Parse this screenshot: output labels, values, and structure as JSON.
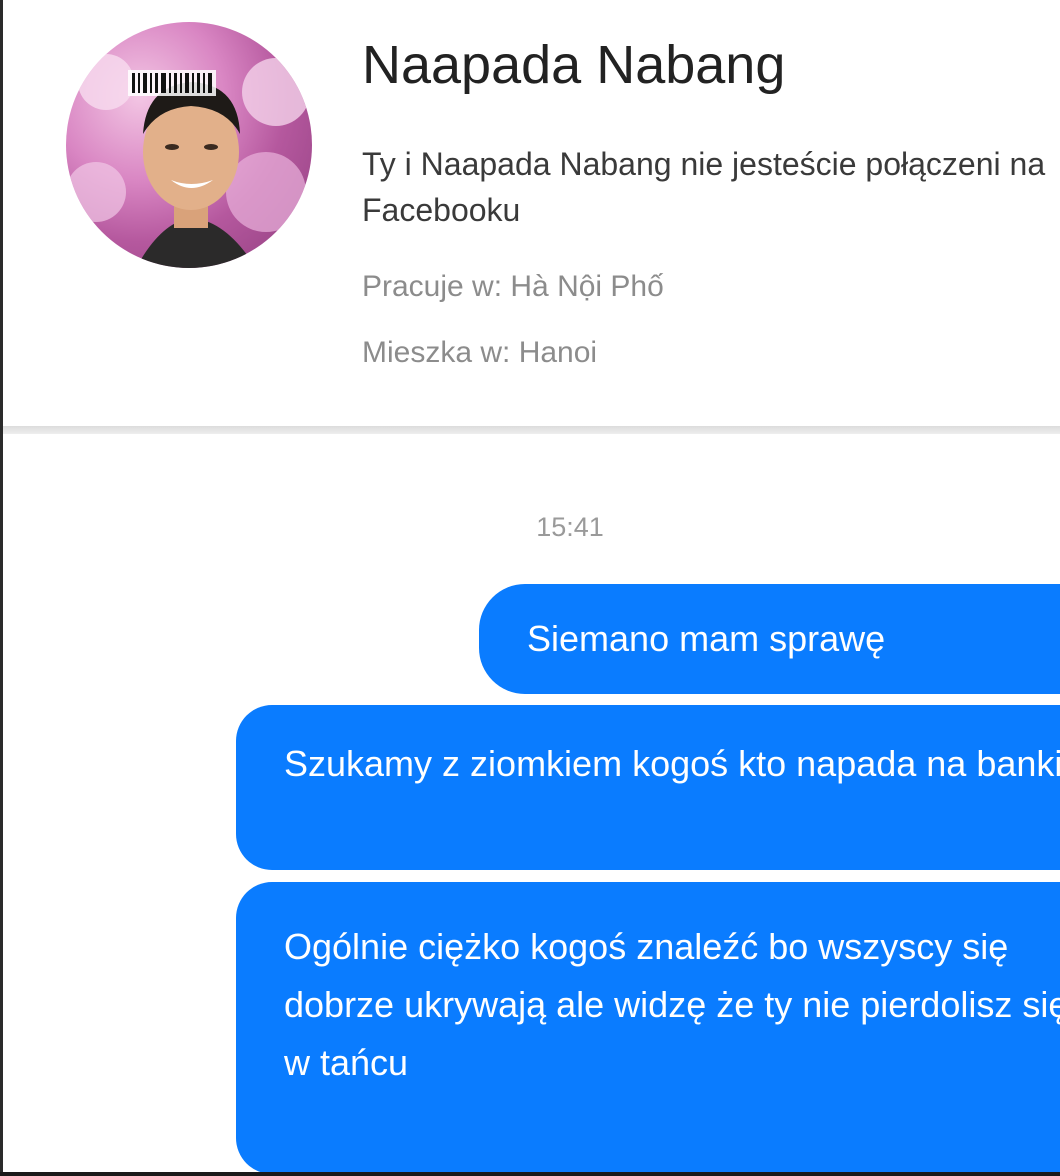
{
  "profile": {
    "name": "Naapada Nabang",
    "connection_status": "Ty i Naapada Nabang nie jesteście połączeni na Facebooku",
    "works_at": "Pracuje w: Hà Nội Phố",
    "lives_in": "Mieszka w: Hanoi"
  },
  "conversation": {
    "timestamp": "15:41",
    "messages": [
      {
        "text": "Siemano mam sprawę"
      },
      {
        "text": "Szukamy z ziomkiem kogoś kto napada na banki"
      },
      {
        "text": "Ogólnie ciężko kogoś znaleźć bo wszyscy się dobrze ukrywają ale widzę że ty nie pierdolisz się w tańcu"
      }
    ]
  },
  "colors": {
    "bubble": "#0a7cff",
    "bubble_text": "#ffffff",
    "secondary_text": "#8c8c8c"
  }
}
